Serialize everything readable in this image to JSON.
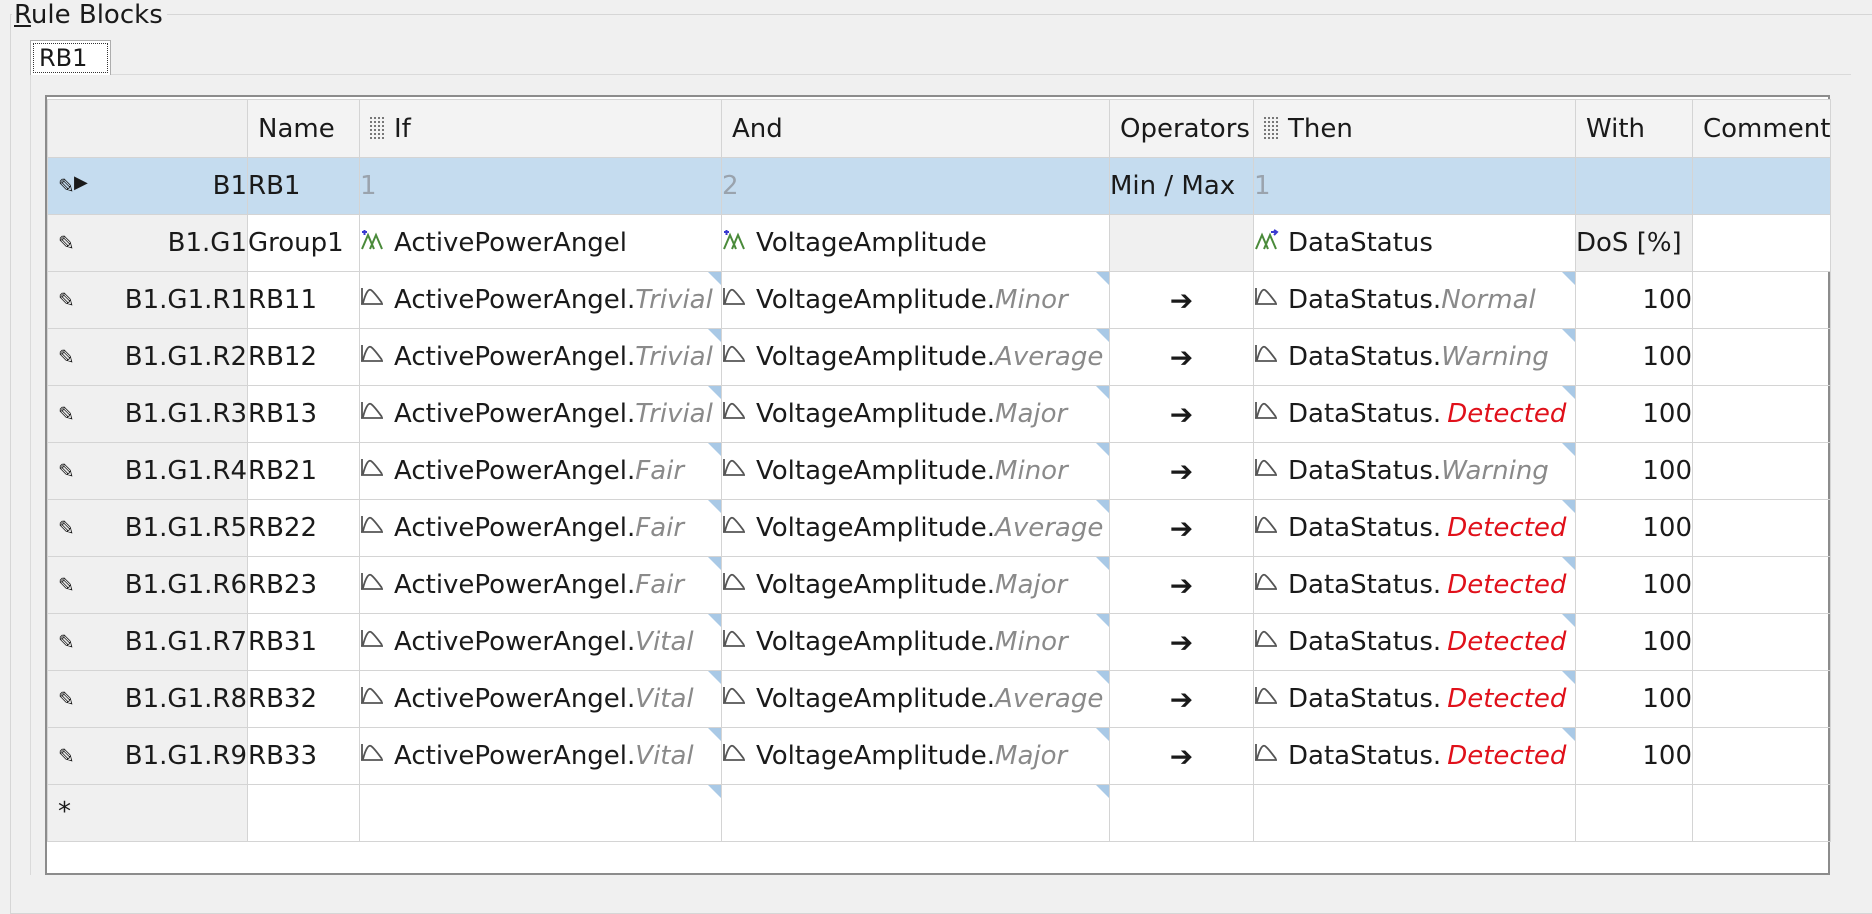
{
  "group_title_first": "R",
  "group_title_rest": "ule Blocks",
  "tab_label": "RB1",
  "columns": {
    "name": "Name",
    "if": "If",
    "and": "And",
    "operators": "Operators",
    "then": "Then",
    "with": "With",
    "comment": "Comment"
  },
  "block_row": {
    "id": "B1",
    "name": "RB1",
    "if": "1",
    "and": "2",
    "operators": "Min / Max",
    "then": "1",
    "with": "",
    "comment": ""
  },
  "group_row": {
    "id": "B1.G1",
    "name": "Group1",
    "if": "ActivePowerAngel",
    "and": "VoltageAmplitude",
    "operators": "",
    "then": "DataStatus",
    "with": "DoS [%]",
    "comment": ""
  },
  "rules": [
    {
      "id": "B1.G1.R1",
      "name": "RB11",
      "if_var": "ActivePowerAngel.",
      "if_mf": "Trivial",
      "and_var": "VoltageAmplitude.",
      "and_mf": "Minor",
      "op": "➔",
      "then_var": "DataStatus.",
      "then_mf": "Normal",
      "then_red": false,
      "with": "100"
    },
    {
      "id": "B1.G1.R2",
      "name": "RB12",
      "if_var": "ActivePowerAngel.",
      "if_mf": "Trivial",
      "and_var": "VoltageAmplitude.",
      "and_mf": "Average",
      "op": "➔",
      "then_var": "DataStatus.",
      "then_mf": "Warning",
      "then_red": false,
      "with": "100"
    },
    {
      "id": "B1.G1.R3",
      "name": "RB13",
      "if_var": "ActivePowerAngel.",
      "if_mf": "Trivial",
      "and_var": "VoltageAmplitude.",
      "and_mf": "Major",
      "op": "➔",
      "then_var": "DataStatus.",
      "then_mf": "Detected",
      "then_red": true,
      "with": "100"
    },
    {
      "id": "B1.G1.R4",
      "name": "RB21",
      "if_var": "ActivePowerAngel.",
      "if_mf": "Fair",
      "and_var": "VoltageAmplitude.",
      "and_mf": "Minor",
      "op": "➔",
      "then_var": "DataStatus.",
      "then_mf": "Warning",
      "then_red": false,
      "with": "100"
    },
    {
      "id": "B1.G1.R5",
      "name": "RB22",
      "if_var": "ActivePowerAngel.",
      "if_mf": "Fair",
      "and_var": "VoltageAmplitude.",
      "and_mf": "Average",
      "op": "➔",
      "then_var": "DataStatus.",
      "then_mf": "Detected",
      "then_red": true,
      "with": "100"
    },
    {
      "id": "B1.G1.R6",
      "name": "RB23",
      "if_var": "ActivePowerAngel.",
      "if_mf": "Fair",
      "and_var": "VoltageAmplitude.",
      "and_mf": "Major",
      "op": "➔",
      "then_var": "DataStatus.",
      "then_mf": "Detected",
      "then_red": true,
      "with": "100"
    },
    {
      "id": "B1.G1.R7",
      "name": "RB31",
      "if_var": "ActivePowerAngel.",
      "if_mf": "Vital",
      "and_var": "VoltageAmplitude.",
      "and_mf": "Minor",
      "op": "➔",
      "then_var": "DataStatus.",
      "then_mf": "Detected",
      "then_red": true,
      "with": "100"
    },
    {
      "id": "B1.G1.R8",
      "name": "RB32",
      "if_var": "ActivePowerAngel.",
      "if_mf": "Vital",
      "and_var": "VoltageAmplitude.",
      "and_mf": "Average",
      "op": "➔",
      "then_var": "DataStatus.",
      "then_mf": "Detected",
      "then_red": true,
      "with": "100"
    },
    {
      "id": "B1.G1.R9",
      "name": "RB33",
      "if_var": "ActivePowerAngel.",
      "if_mf": "Vital",
      "and_var": "VoltageAmplitude.",
      "and_mf": "Major",
      "op": "➔",
      "then_var": "DataStatus.",
      "then_mf": "Detected",
      "then_red": true,
      "with": "100"
    }
  ],
  "new_row_marker": "*",
  "icons": {
    "row_edit": "pencil-icon",
    "row_current": "arrow-right-icon",
    "header_grip": "column-grip-icon",
    "variable": "fuzzy-variable-icon",
    "membership": "membership-function-icon"
  },
  "colors": {
    "selection": "#c5dcef",
    "accent_red": "#e0101a",
    "corner_marker": "#a9c9e6"
  }
}
